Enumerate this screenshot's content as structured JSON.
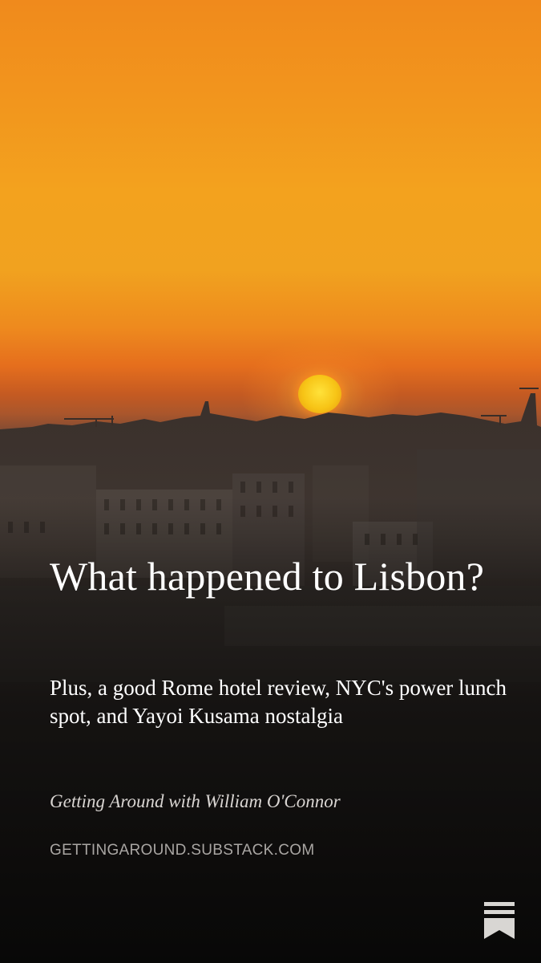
{
  "post": {
    "title": "What happened to Lisbon?",
    "subtitle": "Plus, a good Rome hotel review, NYC's power lunch spot, and Yayoi Kusama nostalgia",
    "author": "Getting Around with William O'Connor",
    "domain": "GETTINGAROUND.SUBSTACK.COM"
  },
  "icons": {
    "logo": "substack-logo-icon"
  },
  "colors": {
    "sky_top": "#f08a1c",
    "sky_mid": "#f3a21e",
    "sun": "#ffe23a",
    "text": "#ffffff",
    "domain_text": "#a9a6a3"
  }
}
